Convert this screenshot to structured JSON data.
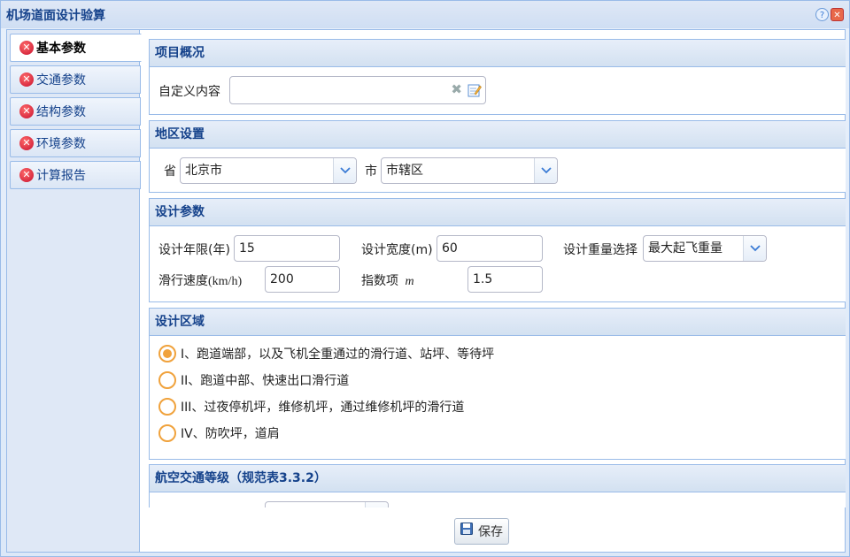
{
  "window": {
    "title": "机场道面设计验算"
  },
  "sidebar": {
    "items": [
      {
        "label": "基本参数",
        "active": true
      },
      {
        "label": "交通参数"
      },
      {
        "label": "结构参数"
      },
      {
        "label": "环境参数"
      },
      {
        "label": "计算报告"
      }
    ]
  },
  "project": {
    "header": "项目概况",
    "custom_label": "自定义内容",
    "custom_value": ""
  },
  "region": {
    "header": "地区设置",
    "province_label": "省",
    "province_value": "北京市",
    "city_label": "市",
    "city_value": "市辖区"
  },
  "design": {
    "header": "设计参数",
    "years_label": "设计年限(年)",
    "years_value": "15",
    "width_label": "设计宽度(m)",
    "width_value": "60",
    "weight_label": "设计重量选择",
    "weight_value": "最大起飞重量",
    "speed_label": "滑行速度(km/h)",
    "speed_value": "200",
    "index_label": "指数项",
    "index_symbol": "m",
    "index_value": "1.5"
  },
  "zone": {
    "header": "设计区域",
    "options": [
      {
        "label": "I、跑道端部，以及飞机全重通过的滑行道、站坪、等待坪",
        "selected": true
      },
      {
        "label": "II、跑道中部、快速出口滑行道"
      },
      {
        "label": "III、过夜停机坪，维修机坪，通过维修机坪的滑行道"
      },
      {
        "label": "IV、防吹坪，道肩"
      }
    ]
  },
  "traffic": {
    "header": "航空交通等级（规范表3.3.2）"
  },
  "footer": {
    "save_label": "保存"
  },
  "colors": {
    "accent": "#15428b",
    "radio": "#f0a23c",
    "error": "#c8102e"
  }
}
